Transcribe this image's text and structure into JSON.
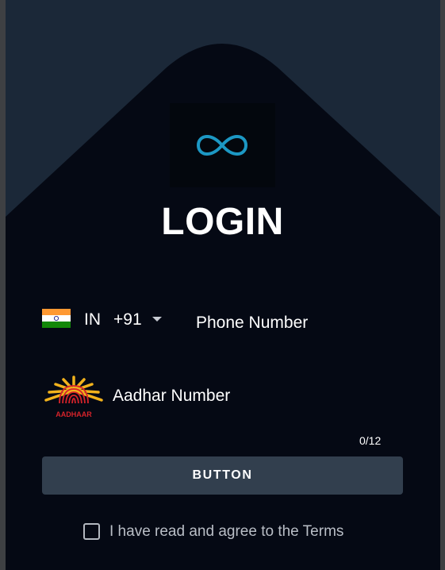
{
  "header": {
    "title": "LOGIN"
  },
  "logo": {
    "icon": "infinity-icon",
    "color": "#1fa8d8"
  },
  "phone": {
    "country": "IN",
    "dial_code": "+91",
    "flag_icon": "india-flag-icon",
    "placeholder": "Phone Number",
    "value": ""
  },
  "aadhar": {
    "logo_icon": "aadhaar-logo-icon",
    "logo_text": "AADHAAR",
    "placeholder": "Aadhar Number",
    "value": "",
    "counter": "0/12"
  },
  "action": {
    "button_label": "BUTTON"
  },
  "terms": {
    "checked": false,
    "label": "I have read and agree to the Terms"
  },
  "colors": {
    "background": "#1b2838",
    "panel": "#050914",
    "button": "#323f4e",
    "text": "#ffffff"
  }
}
